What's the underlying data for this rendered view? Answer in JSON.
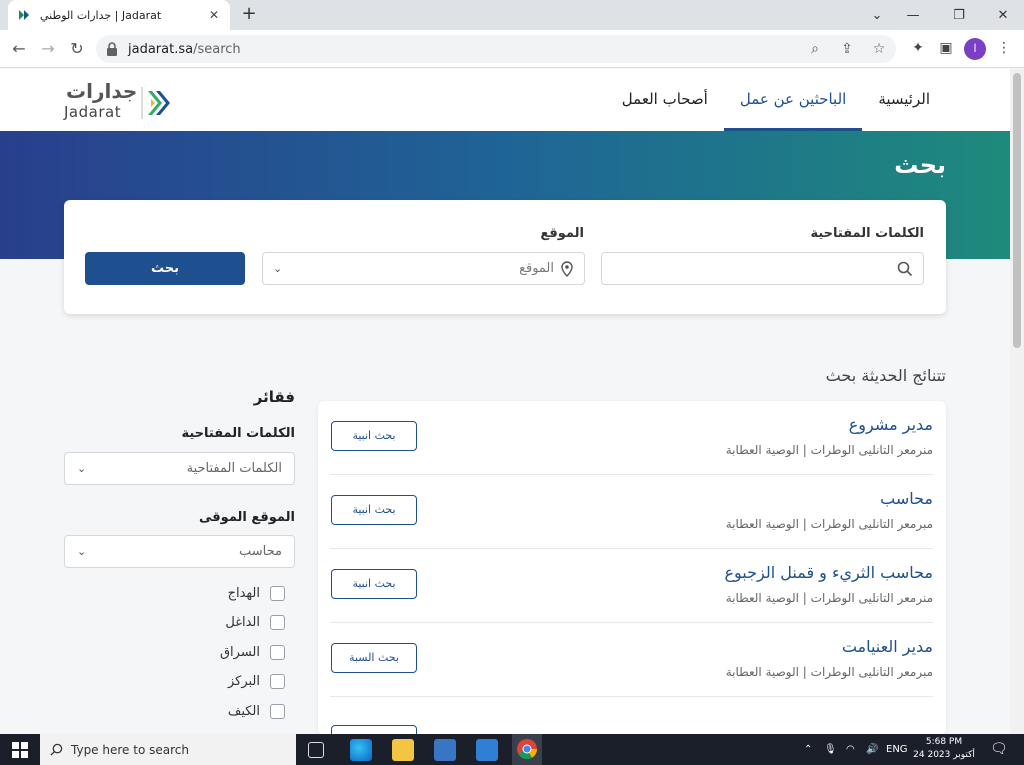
{
  "browser": {
    "tab_title": "جدارات الوطني | Jadarat",
    "url_host": "jadarat.sa",
    "url_path": "/search",
    "profile_initial": "ا"
  },
  "site": {
    "logo_ar": "جدارات",
    "logo_en": "Jadarat",
    "nav": [
      {
        "label": "الرئيسية"
      },
      {
        "label": "الباحثين عن عمل"
      },
      {
        "label": "أصحاب العمل"
      }
    ]
  },
  "hero": {
    "title": "بحث"
  },
  "search": {
    "keywords_label": "الكلمات المفتاحية",
    "location_label": "الموقع",
    "location_placeholder": "الموقع",
    "button_label": "بحث"
  },
  "results": {
    "title": "تتنائج الحديثة بحث",
    "items": [
      {
        "title": "مدير مشروع",
        "subtitle": "منرمعر التانليى الوطرات | الوصية العطابة",
        "button": "بحث انبية"
      },
      {
        "title": "محاسب",
        "subtitle": "مبرمعر التانليى الوطرات | الوصية العطابة",
        "button": "بحث انبية"
      },
      {
        "title": "محاسب الثريء و قمنل الزجبوع",
        "subtitle": "منرمعر التانليى الوطرات | الوصية العطابة",
        "button": "بحث انبية"
      },
      {
        "title": "مدير العنيامت",
        "subtitle": "مبرمعر التانليى الوطرات | الوصية العطابة",
        "button": "بحث السبة"
      }
    ]
  },
  "filters": {
    "title": "فقائر",
    "keywords_label": "الكلمات المفتاحية",
    "keywords_value": "الكلمات المفتاحية",
    "location_label": "الموقع الموقى",
    "location_value": "محاسب",
    "checkboxes": [
      {
        "label": "الهداج"
      },
      {
        "label": "الداغل"
      },
      {
        "label": "السراق"
      },
      {
        "label": "البركز"
      },
      {
        "label": "الكيف"
      }
    ]
  },
  "taskbar": {
    "search_placeholder": "Type here to search",
    "lang": "ENG",
    "time": "5:68 PM",
    "date": "24 أكتوبر 2023"
  }
}
